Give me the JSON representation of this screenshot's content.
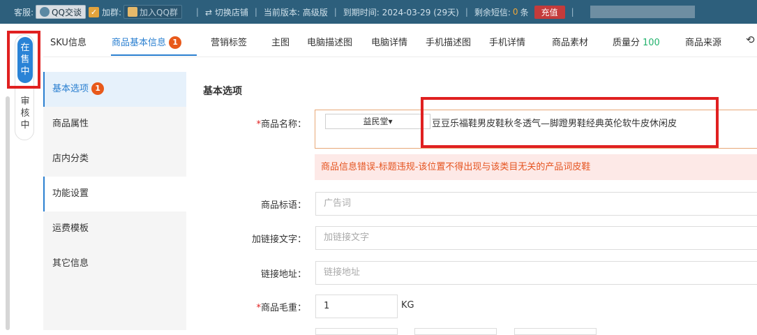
{
  "topbar": {
    "support_label": "客服:",
    "qq_chat": "QQ交谈",
    "join_label": "加群:",
    "join_group": "加入QQ群",
    "switch_shop": "⇄ 切换店铺",
    "version": "当前版本: 高级版",
    "expiry": "到期时间: 2024-03-29 (29天)",
    "sms_label": "剩余短信:",
    "sms_count": "0",
    "sms_unit": "条",
    "recharge": "充值"
  },
  "status_tabs": {
    "on_sale": "在售中",
    "reviewing": "审核中"
  },
  "tabs": [
    {
      "label": "SKU信息"
    },
    {
      "label": "商品基本信息",
      "badge": "1"
    },
    {
      "label": "营销标签"
    },
    {
      "label": "主图"
    },
    {
      "label": "电脑描述图"
    },
    {
      "label": "电脑详情"
    },
    {
      "label": "手机描述图"
    },
    {
      "label": "手机详情"
    },
    {
      "label": "商品素材"
    },
    {
      "label": "质量分",
      "score": "100"
    },
    {
      "label": "商品来源"
    }
  ],
  "sidenav": [
    {
      "label": "基本选项",
      "badge": "1"
    },
    {
      "label": "商品属性"
    },
    {
      "label": "店内分类"
    },
    {
      "label": "功能设置"
    },
    {
      "label": "运费模板"
    },
    {
      "label": "其它信息"
    }
  ],
  "form": {
    "section_title": "基本选项",
    "name_label": "商品名称：",
    "name_required": "*",
    "shop_select": "益民堂▾",
    "name_value": "豆豆乐福鞋男皮鞋秋冬透气—脚蹬男鞋经典英伦软牛皮休闲皮",
    "error": "商品信息错误-标题违规-该位置不得出现与该类目无关的产品词皮鞋",
    "slogan_label": "商品标语：",
    "slogan_placeholder": "广告词",
    "link_text_label": "加链接文字：",
    "link_text_placeholder": "加链接文字",
    "link_url_label": "链接地址：",
    "link_url_placeholder": "链接地址",
    "weight_required": "*",
    "weight_label": "商品毛重：",
    "weight_value": "1",
    "weight_unit": "KG"
  }
}
